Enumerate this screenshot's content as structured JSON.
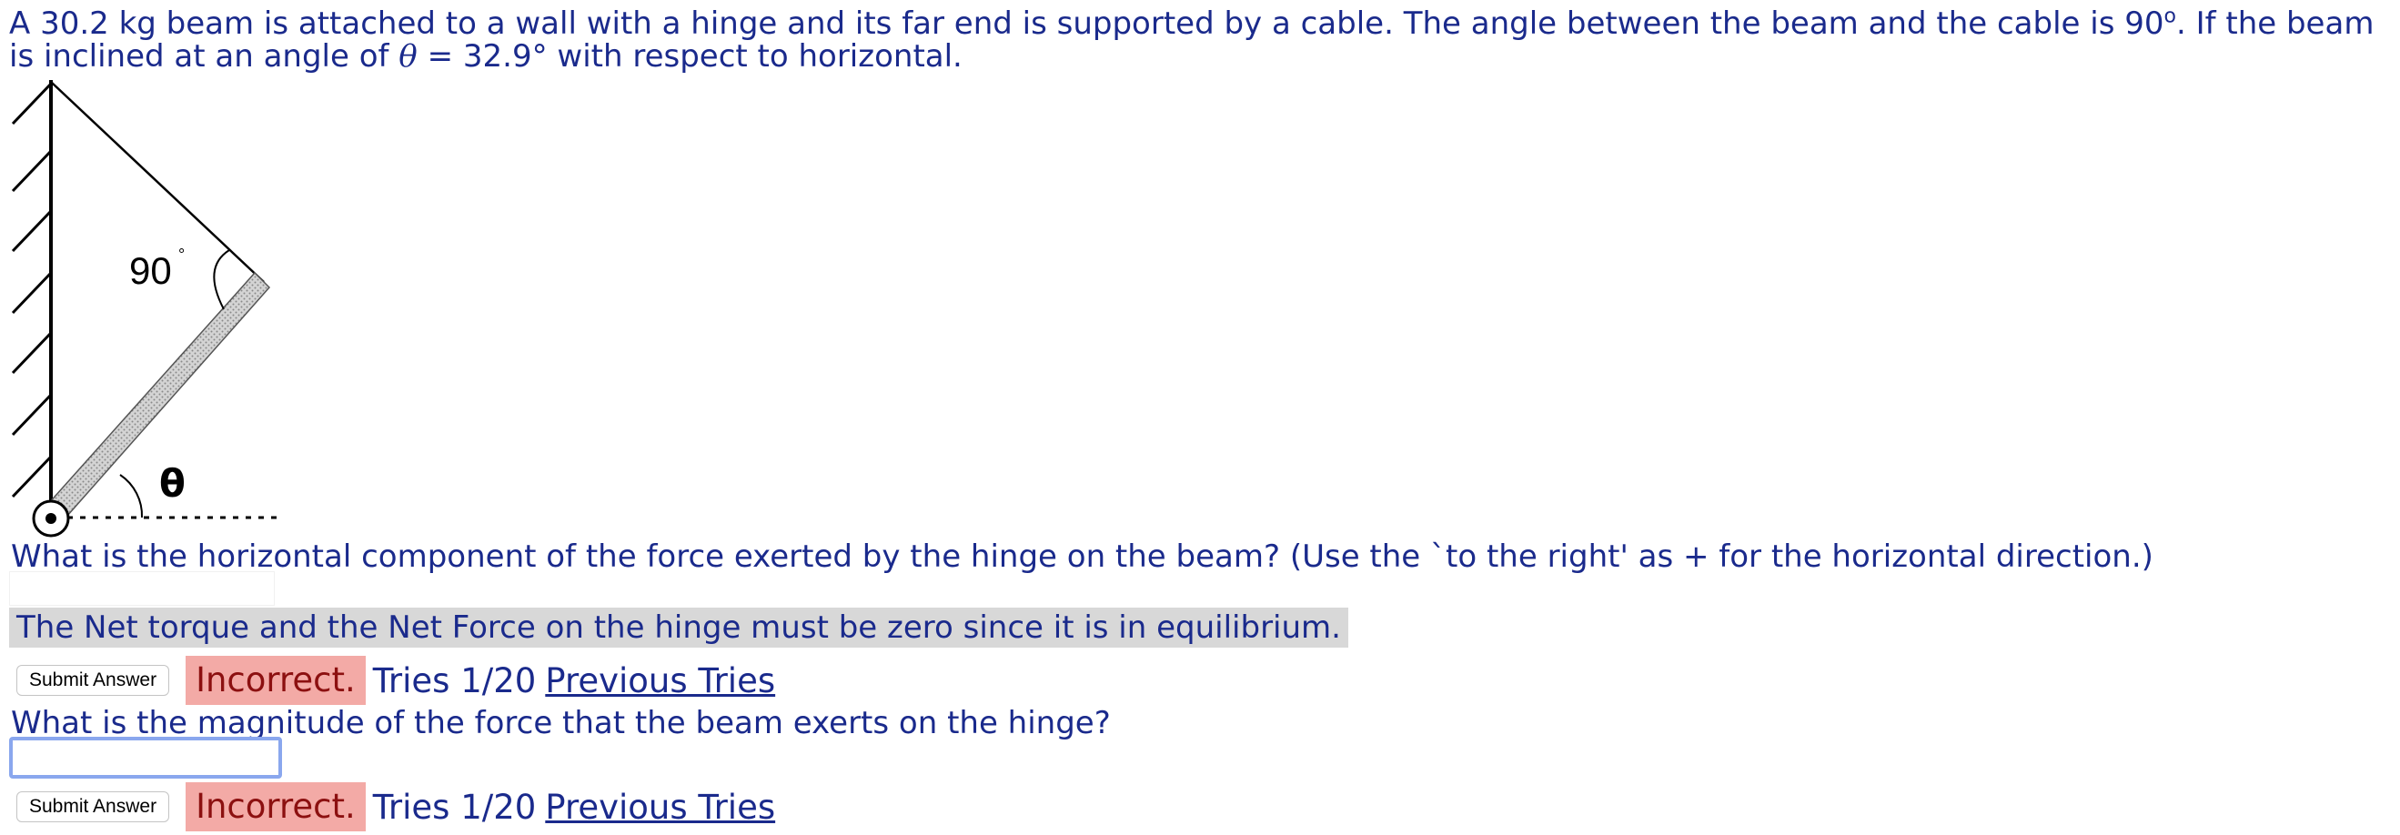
{
  "problem": {
    "part1": "A 30.2 kg beam is attached to a wall with a hinge and its far end is supported by a cable. The angle between the beam and the cable is 90",
    "degree_sup": "o",
    "part2": ". If the beam is inclined at an angle of ",
    "theta_symbol": "θ",
    "part3": " = 32.9° with respect to horizontal."
  },
  "figure": {
    "angle_label_90": "90",
    "theta_label": "θ"
  },
  "question1": {
    "text": "What is the horizontal component of the force exerted by the hinge on the beam? (Use the `to the right' as + for the horizontal direction.)",
    "input_value": "",
    "hint": "The Net torque and the Net Force on the hinge must be zero since it is in equilibrium.",
    "submit_label": "Submit Answer",
    "status": "Incorrect.",
    "tries": "Tries 1/20",
    "previous_tries_label": "Previous Tries"
  },
  "question2": {
    "text": "What is the magnitude of the force that the beam exerts on the hinge?",
    "input_value": "",
    "submit_label": "Submit Answer",
    "status": "Incorrect.",
    "tries": "Tries 1/20",
    "previous_tries_label": "Previous Tries"
  },
  "colors": {
    "text": "#1a2a8c",
    "incorrect_bg": "#f3aaa6",
    "incorrect_text": "#8c1010",
    "hint_bg": "#d8d8d8",
    "focus_border": "#8aa7ee"
  }
}
